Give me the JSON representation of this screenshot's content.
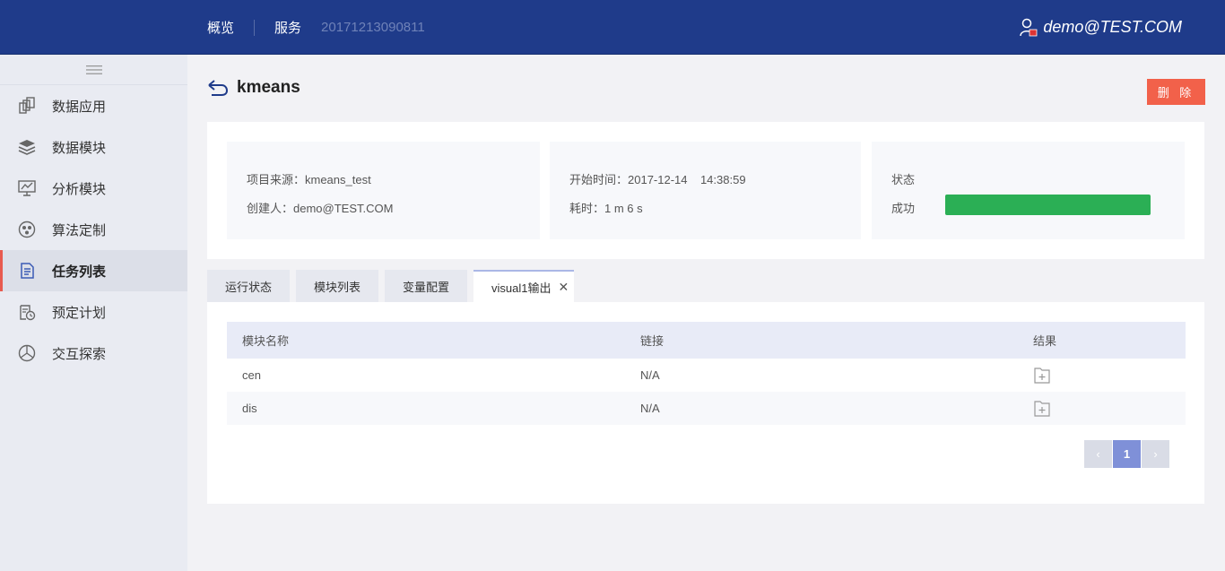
{
  "topbar": {
    "nav": [
      {
        "label": "概览"
      },
      {
        "label": "服务"
      }
    ],
    "sub_label": "20171213090811",
    "user": "demo@TEST.COM"
  },
  "sidebar": {
    "items": [
      {
        "label": "数据应用",
        "icon": "data-app-icon"
      },
      {
        "label": "数据模块",
        "icon": "layers-icon"
      },
      {
        "label": "分析模块",
        "icon": "monitor-chart-icon"
      },
      {
        "label": "算法定制",
        "icon": "dots-circle-icon"
      },
      {
        "label": "任务列表",
        "icon": "document-list-icon",
        "active": true
      },
      {
        "label": "预定计划",
        "icon": "calendar-clock-icon"
      },
      {
        "label": "交互探索",
        "icon": "compass-icon"
      }
    ]
  },
  "page": {
    "title": "kmeans",
    "delete_label": "删 除"
  },
  "info": {
    "source": "项目来源：kmeans_test",
    "creator": "创建人：demo@TEST.COM",
    "start_time": "开始时间：2017-12-14    14:38:59",
    "duration": "耗时：1 m 6 s",
    "status_label": "状态",
    "status_value": "成功",
    "status_progress": 1.0,
    "status_color": "#2baf55"
  },
  "tabs": [
    {
      "label": "运行状态"
    },
    {
      "label": "模块列表"
    },
    {
      "label": "变量配置"
    },
    {
      "label": "visual1输出",
      "active": true
    }
  ],
  "table": {
    "headers": [
      "模块名称",
      "链接",
      "结果"
    ],
    "rows": [
      {
        "name": "cen",
        "link": "N/A"
      },
      {
        "name": "dis",
        "link": "N/A"
      }
    ]
  },
  "pagination": {
    "prev": "‹",
    "current": "1",
    "next": "›"
  },
  "colors": {
    "topbar": "#1f3b8a",
    "accent_red": "#f2614a",
    "page_active": "#7f90d8"
  }
}
